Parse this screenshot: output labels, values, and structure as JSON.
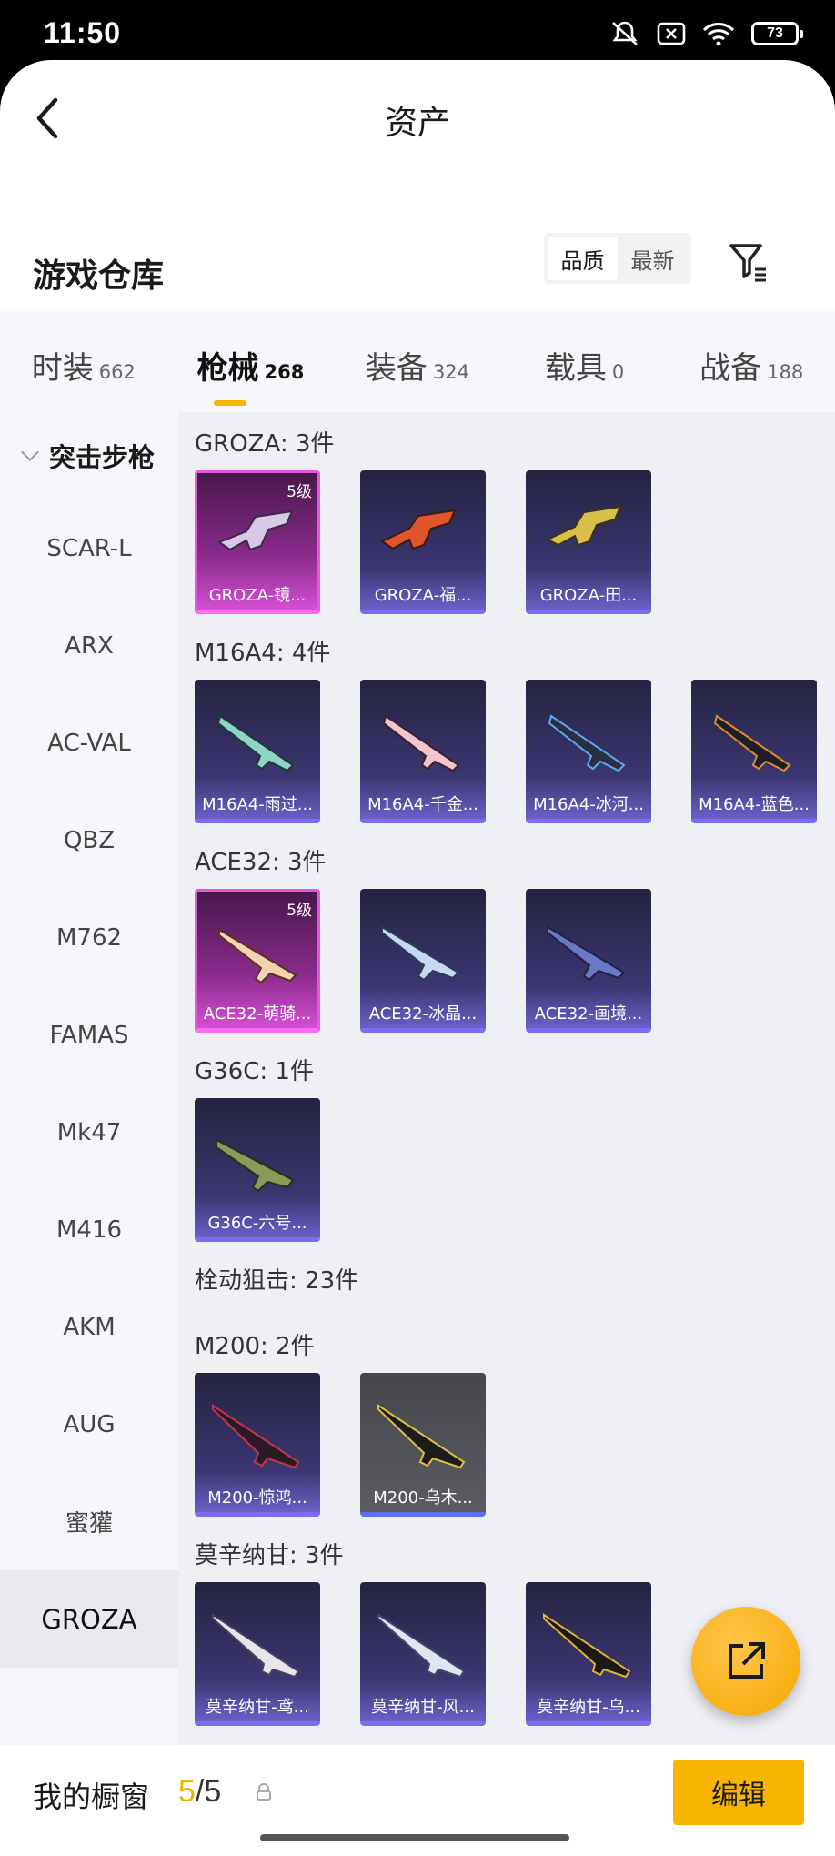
{
  "status": {
    "time": "11:50",
    "battery": "73"
  },
  "header": {
    "title": "资产"
  },
  "warehouse": {
    "title": "游戏仓库",
    "sort_options": [
      "品质",
      "最新"
    ]
  },
  "tabs": [
    {
      "label": "时装",
      "count": "662"
    },
    {
      "label": "枪械",
      "count": "268"
    },
    {
      "label": "装备",
      "count": "324"
    },
    {
      "label": "载具",
      "count": "0"
    },
    {
      "label": "战备",
      "count": "188"
    }
  ],
  "sidebar": {
    "category": "突击步枪",
    "items": [
      "SCAR-L",
      "ARX",
      "AC-VAL",
      "QBZ",
      "M762",
      "FAMAS",
      "Mk47",
      "M416",
      "AKM",
      "AUG",
      "蜜獾",
      "GROZA"
    ]
  },
  "groups": [
    {
      "title": "GROZA: 3件",
      "items": [
        {
          "name": "GROZA-镜...",
          "level": "5级",
          "rarity": "pink"
        },
        {
          "name": "GROZA-福...",
          "rarity": "purple"
        },
        {
          "name": "GROZA-田...",
          "rarity": "purple"
        }
      ]
    },
    {
      "title": "M16A4: 4件",
      "items": [
        {
          "name": "M16A4-雨过...",
          "rarity": "purple"
        },
        {
          "name": "M16A4-千金...",
          "rarity": "purple"
        },
        {
          "name": "M16A4-冰河...",
          "rarity": "purple"
        },
        {
          "name": "M16A4-蓝色...",
          "rarity": "purple"
        }
      ]
    },
    {
      "title": "ACE32: 3件",
      "items": [
        {
          "name": "ACE32-萌骑...",
          "level": "5级",
          "rarity": "pink"
        },
        {
          "name": "ACE32-冰晶...",
          "rarity": "purple"
        },
        {
          "name": "ACE32-画境...",
          "rarity": "purple"
        }
      ]
    },
    {
      "title": "G36C: 1件",
      "items": [
        {
          "name": "G36C-六号...",
          "rarity": "purple"
        }
      ]
    },
    {
      "title": "栓动狙击: 23件",
      "items": []
    },
    {
      "title": "M200: 2件",
      "items": [
        {
          "name": "M200-惊鸿...",
          "rarity": "purple"
        },
        {
          "name": "M200-乌木...",
          "rarity": "gray"
        }
      ]
    },
    {
      "title": "莫辛纳甘: 3件",
      "items": [
        {
          "name": "莫辛纳甘-鸢...",
          "rarity": "purple"
        },
        {
          "name": "莫辛纳甘-风...",
          "rarity": "purple"
        },
        {
          "name": "莫辛纳甘-乌...",
          "rarity": "purple"
        }
      ]
    }
  ],
  "showcase": {
    "label": "我的橱窗",
    "current": "5",
    "total": "/5",
    "edit_label": "编辑"
  }
}
